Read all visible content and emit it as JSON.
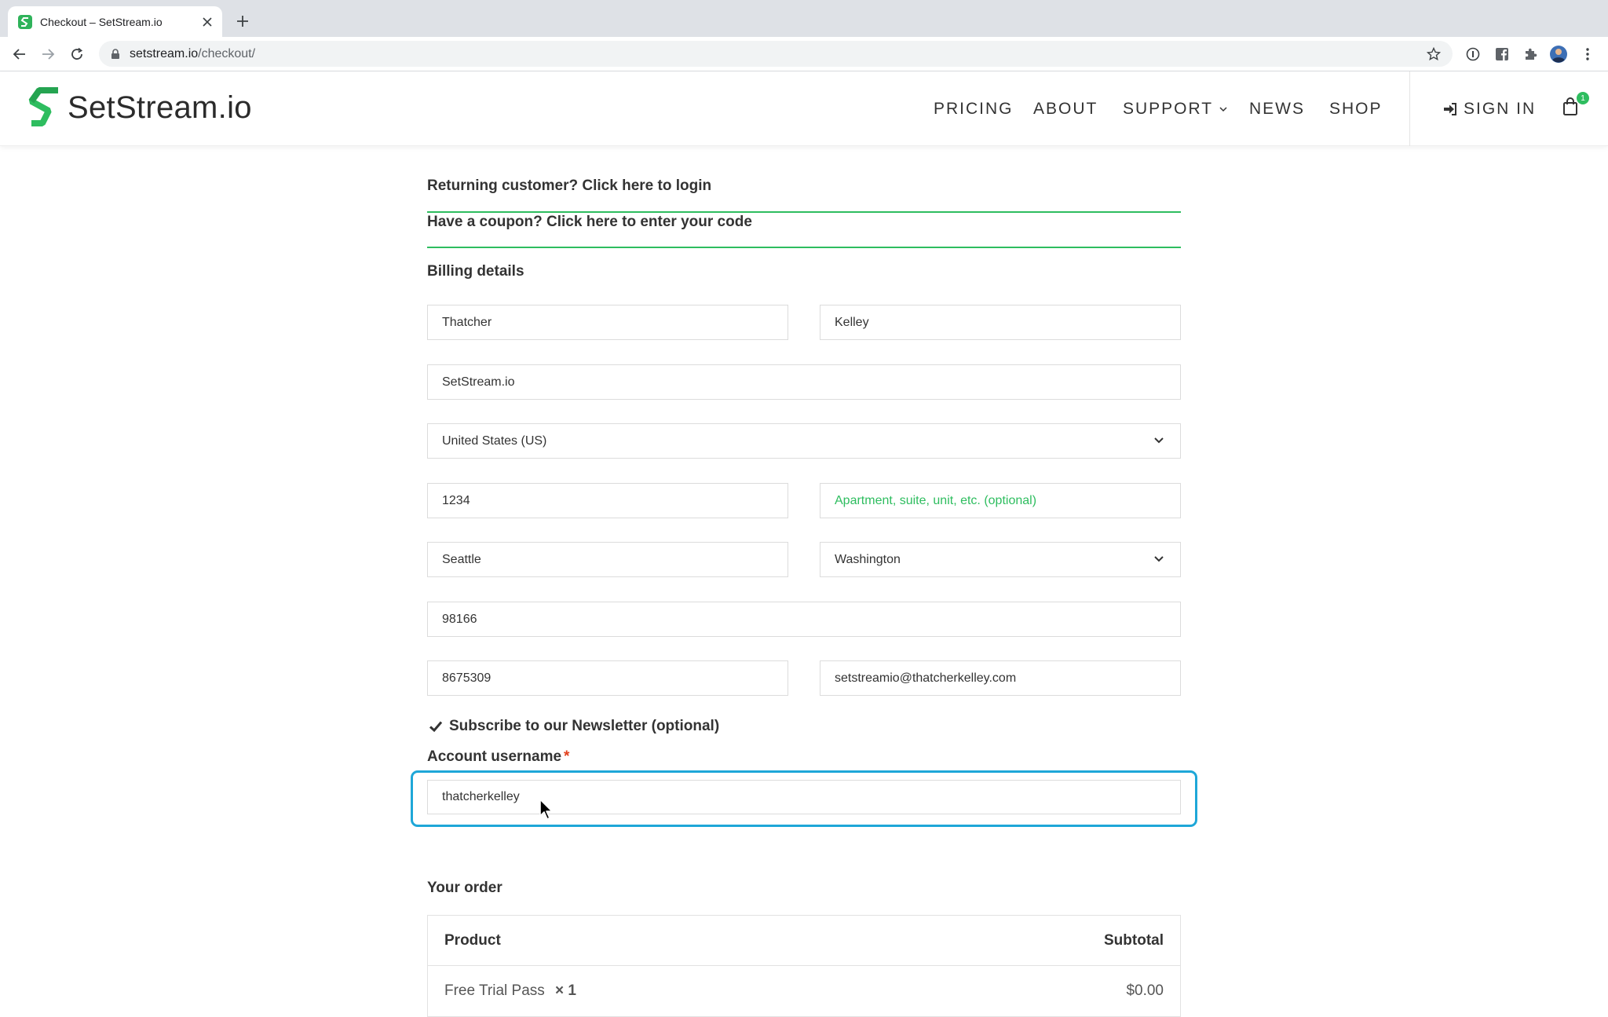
{
  "browser": {
    "tab_title": "Checkout – SetStream.io",
    "url_host": "setstream.io",
    "url_path": "/checkout/"
  },
  "site": {
    "brand": "SetStream.io",
    "nav": {
      "pricing": "PRICING",
      "about": "ABOUT",
      "support": "SUPPORT",
      "news": "NEWS",
      "shop": "SHOP",
      "sign_in": "SIGN IN"
    },
    "cart_count": "1",
    "accent_color": "#2ebd5f",
    "focus_color": "#1ea7d8"
  },
  "checkout": {
    "returning_notice": "Returning customer? Click here to login",
    "coupon_notice": "Have a coupon? Click here to enter your code",
    "billing_title": "Billing details",
    "fields": {
      "first_name": "Thatcher",
      "last_name": "Kelley",
      "company": "SetStream.io",
      "country": "United States (US)",
      "address_1": "1234",
      "address_2_placeholder": "Apartment, suite, unit, etc. (optional)",
      "city": "Seattle",
      "state": "Washington",
      "postcode": "98166",
      "phone": "8675309",
      "email": "setstreamio@thatcherkelley.com"
    },
    "newsletter_label": "Subscribe to our Newsletter (optional)",
    "newsletter_checked": true,
    "username_label": "Account username",
    "username_required_mark": "*",
    "username_value": "thatcherkelley",
    "order_title": "Your order",
    "order_table": {
      "headers": [
        "Product",
        "Subtotal"
      ],
      "rows": [
        {
          "product": "Free Trial Pass",
          "qty": "× 1",
          "subtotal": "$0.00"
        }
      ]
    }
  }
}
